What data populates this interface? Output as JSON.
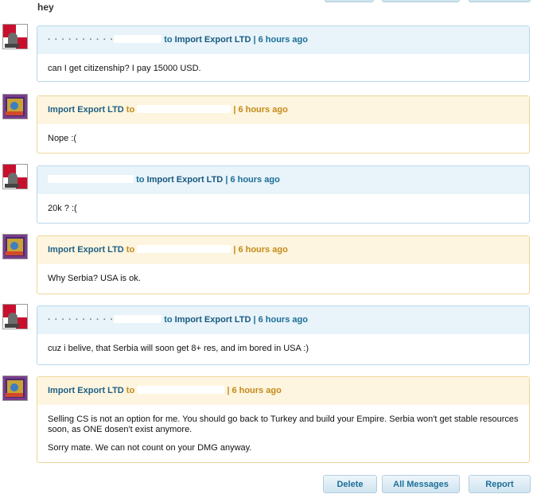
{
  "thread": {
    "subject": "hey"
  },
  "messages": [
    {
      "from": "",
      "to_word": "to",
      "to": "Import Export LTD",
      "time": "| 6 hours ago",
      "lines": [
        "can I get citizenship? I pay 15000 USD."
      ]
    },
    {
      "from": "Import Export LTD",
      "to_word": "to",
      "to": "",
      "time": "| 6 hours ago",
      "lines": [
        "Nope :("
      ]
    },
    {
      "from": "",
      "to_word": "to",
      "to": "Import Export LTD",
      "time": "| 6 hours ago",
      "lines": [
        "20k ? :("
      ]
    },
    {
      "from": "Import Export LTD",
      "to_word": "to",
      "to": "",
      "time": "| 6 hours ago",
      "lines": [
        "Why Serbia? USA is ok."
      ]
    },
    {
      "from": "",
      "to_word": "to",
      "to": "Import Export LTD",
      "time": "| 6 hours ago",
      "lines": [
        "cuz i belive, that Serbia will soon get 8+ res, and im bored in USA :)"
      ]
    },
    {
      "from": "Import Export LTD",
      "to_word": "to",
      "to": "",
      "time": "| 6 hours ago",
      "lines": [
        "Selling CS is not an option for me. You should go back to Turkey and build your Empire. Serbia won't get stable resources soon, as ONE dosen't exist anymore.",
        "Sorry mate. We can not count on your DMG anyway."
      ]
    }
  ],
  "actions": {
    "delete": "Delete",
    "all_messages": "All Messages",
    "report": "Report"
  },
  "colors": {
    "blue_header": "#e8f3fa",
    "blue_border": "#b7d7ea",
    "yellow_header": "#fdf5df",
    "yellow_border": "#ecd69a",
    "link": "#1e6f9a",
    "orange_meta": "#c58a19"
  }
}
